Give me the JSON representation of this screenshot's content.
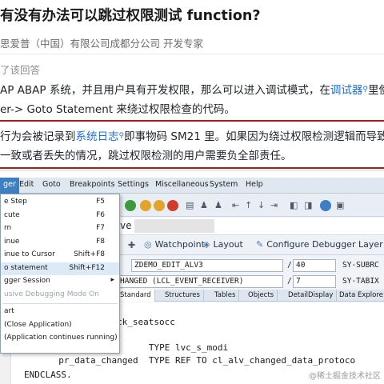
{
  "article": {
    "title": "有没有办法可以跳过权限测试 function?",
    "author_line": "思爱普（中国）有限公司成都分公司 开发专家",
    "invited_text": "了该回答",
    "p1_line1_pre": "AP ABAP 系统，并且用户具有开发权限，那么可以进入调试模式，在",
    "p1_line1_link": "调试器",
    "p1_line1_post": "里使",
    "p1_line2": "er-> Goto Statement 来绕过权限检查的代码。",
    "p2_line1_pre": "行为会被记录到",
    "p2_line1_link": "系统日志",
    "p2_line1_post": "即事物码 SM21 里。如果因为绕过权限检测逻辑而导致",
    "p2_line2": "一致或者丢失的情况，跳过权限检测的用户需要负全部责任。",
    "search_glyph": "⚲"
  },
  "sap": {
    "menu": [
      "ger",
      "Edit",
      "Goto",
      "Breakpoints",
      "Settings",
      "Miscellaneous",
      "System",
      "Help"
    ],
    "toolbar_buttons": {
      "watchpoint": "Watchpoint",
      "layout": "Layout",
      "configure": "Configure Debugger Layer"
    },
    "field_row1": {
      "value": "ZDEMO_EDIT_ALV3",
      "slash_value": "40",
      "right_label": "SY-SUBRC"
    },
    "field_row2": {
      "value": "HANGED (LCL_EVENT_RECEIVER)",
      "slash_value": "7",
      "right_label": "SY-TABIX"
    },
    "input_value": "ve",
    "tabs": [
      "Standard",
      "Structures",
      "Tables",
      "Objects",
      "DetailDisplay",
      "Data Explore"
    ],
    "active_tab": "Standard",
    "code_lines": [
      {
        "text": "ck_seatsocc"
      },
      {
        "text": "  ps_good          TYPE lvc_s_modi"
      },
      {
        "text": "  pr_data_changed  TYPE REF TO cl_alv_changed_data_protoco"
      },
      {
        "text": "ENDCLASS."
      }
    ],
    "dropdown": [
      {
        "label": "e Step",
        "shortcut": "F5"
      },
      {
        "label": "cute",
        "shortcut": "F6"
      },
      {
        "label": "rn",
        "shortcut": "F7"
      },
      {
        "label": "inue",
        "shortcut": "F8"
      },
      {
        "label": "inue to Cursor",
        "shortcut": "Shift+F8"
      },
      {
        "label": "o statement",
        "shortcut": "Shift+F12"
      },
      {
        "label": "gger Session",
        "shortcut": ""
      },
      {
        "label": "usive Debugging Mode On",
        "shortcut": ""
      },
      {
        "label": "art",
        "shortcut": ""
      },
      {
        "label": "(Close Application)",
        "shortcut": ""
      },
      {
        "label": "(Application continues running)",
        "shortcut": ""
      }
    ],
    "watermark": "@稀土掘金技术社区"
  },
  "colors": {
    "link": "#1e6fd9",
    "red_bar": "#b21a1a",
    "sap_menu_active": "#3d7fc0",
    "keyword": "#2b2bd4"
  }
}
